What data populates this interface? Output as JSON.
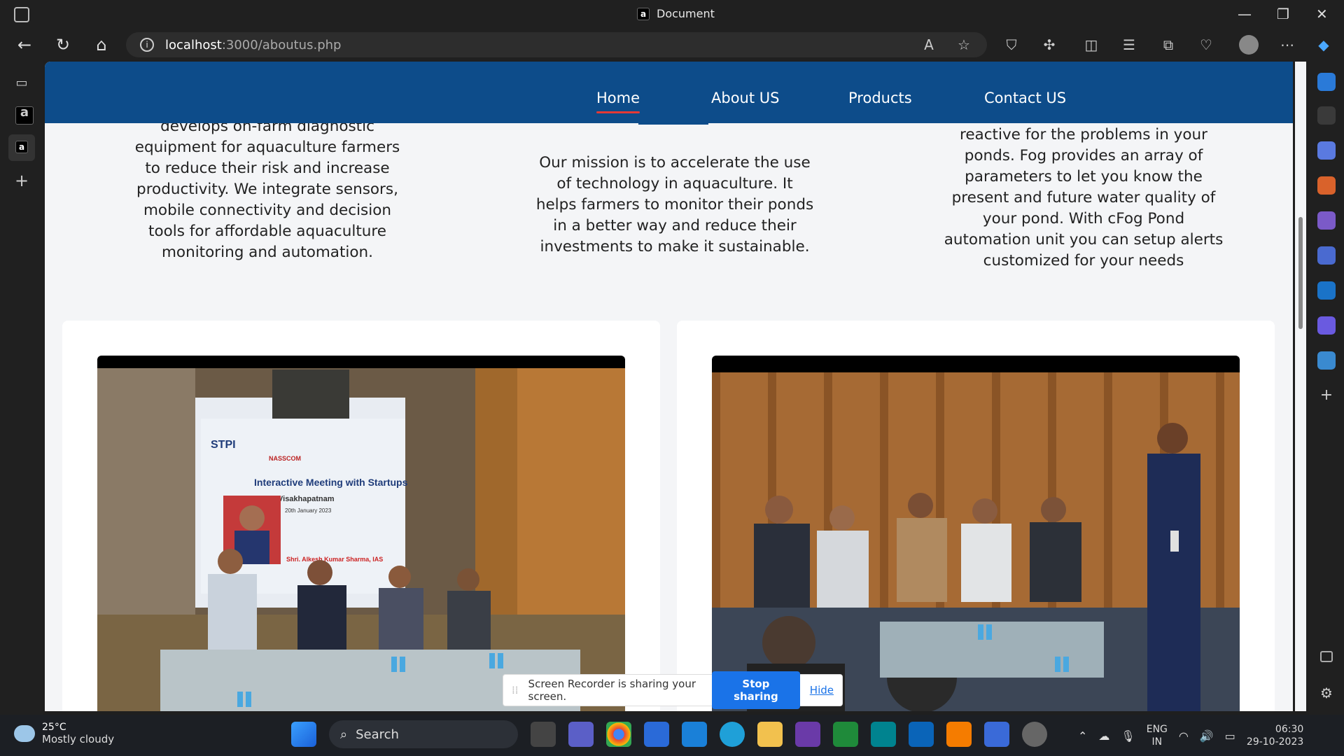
{
  "window": {
    "title": "Document"
  },
  "browser": {
    "url_host": "localhost",
    "url_path": ":3000/aboutus.php"
  },
  "site_nav": [
    {
      "label": "Home",
      "active": true
    },
    {
      "label": "About US",
      "active": false
    },
    {
      "label": "Products",
      "active": false
    },
    {
      "label": "Contact US",
      "active": false
    }
  ],
  "columns": {
    "left": "develops on-farm diagnostic equipment for aquaculture farmers to reduce their risk and increase productivity. We integrate sensors, mobile connectivity and decision tools for affordable aquaculture monitoring and automation.",
    "middle": "Our mission is to accelerate the use of technology in aquaculture. It helps farmers to monitor their ponds in a better way and reduce their investments to make it sustainable.",
    "right": "reactive for the problems in your ponds. Fog provides an array of parameters to let you know the present and future water quality of your pond. With cFog Pond automation unit you can setup alerts customized for your needs"
  },
  "photo1": {
    "banner_title": "Interactive Meeting with Startups",
    "banner_city": "Visakhapatnam",
    "banner_date": "20th January 2023",
    "banner_name": "Shri. Alkesh Kumar Sharma, IAS",
    "logos": [
      "STPI",
      "NASSCOM"
    ]
  },
  "recorder": {
    "message": "Screen Recorder is sharing your screen.",
    "stop_label": "Stop sharing",
    "hide_label": "Hide"
  },
  "taskbar": {
    "temp": "25°C",
    "weather": "Mostly cloudy",
    "search_label": "Search",
    "lang_1": "ENG",
    "lang_2": "IN",
    "time": "06:30",
    "date": "29-10-2023"
  }
}
